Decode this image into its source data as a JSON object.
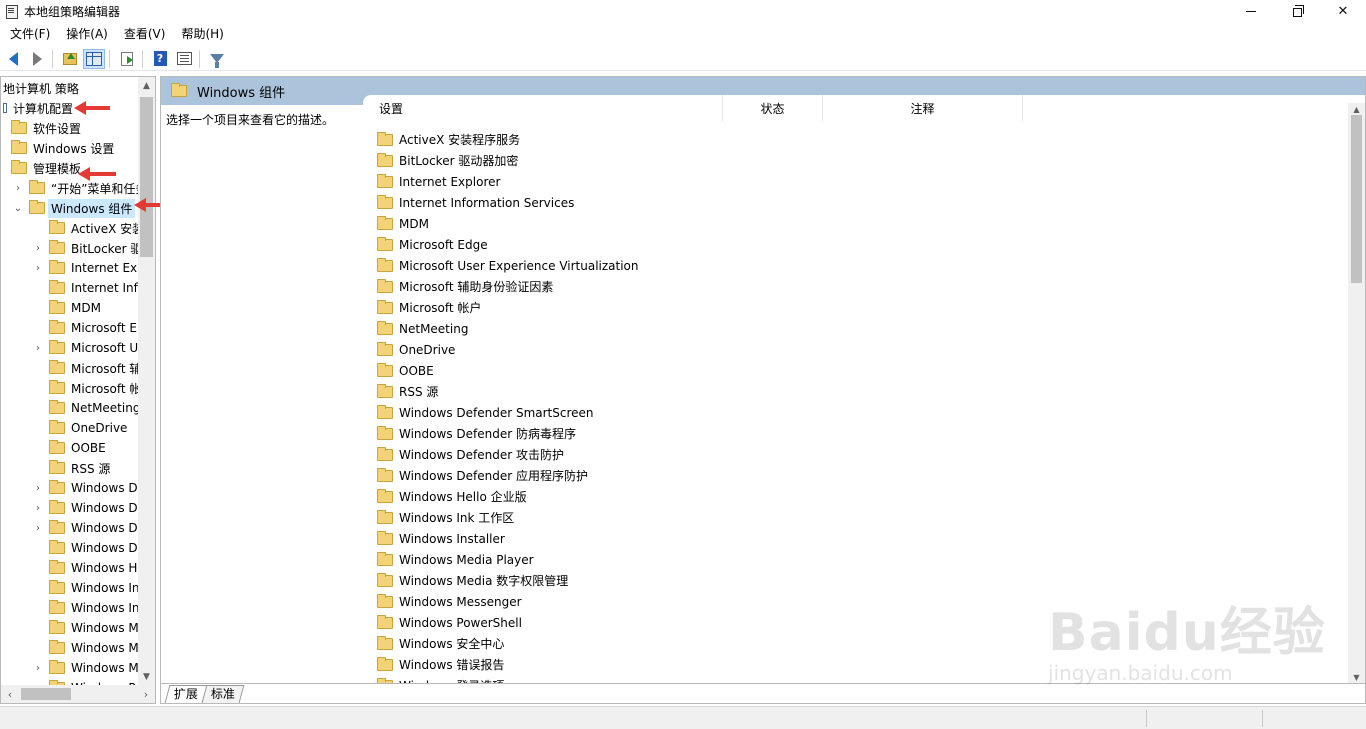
{
  "window": {
    "title": "本地组策略编辑器"
  },
  "menu": [
    "文件(F)",
    "操作(A)",
    "查看(V)",
    "帮助(H)"
  ],
  "toolbar": {
    "buttons": [
      "back-icon",
      "forward-icon",
      "up-folder-icon",
      "show-hide-tree-icon",
      "export-list-icon",
      "help-icon",
      "properties-icon",
      "filter-icon"
    ],
    "help_glyph": "?"
  },
  "tree": {
    "root": "地计算机 策略",
    "computer_config": "计算机配置",
    "software_settings": "软件设置",
    "windows_settings": "Windows 设置",
    "admin_templates": "管理模板",
    "start_menu": "“开始”菜单和任务",
    "windows_components": "Windows 组件",
    "children": [
      {
        "label": "ActiveX 安装",
        "expandable": false
      },
      {
        "label": "BitLocker 驱",
        "expandable": true
      },
      {
        "label": "Internet Exp",
        "expandable": true
      },
      {
        "label": "Internet Info",
        "expandable": false
      },
      {
        "label": "MDM",
        "expandable": false
      },
      {
        "label": "Microsoft E",
        "expandable": false
      },
      {
        "label": "Microsoft U",
        "expandable": true
      },
      {
        "label": "Microsoft 辅",
        "expandable": false
      },
      {
        "label": "Microsoft 帐",
        "expandable": false
      },
      {
        "label": "NetMeeting",
        "expandable": false
      },
      {
        "label": "OneDrive",
        "expandable": false
      },
      {
        "label": "OOBE",
        "expandable": false
      },
      {
        "label": "RSS 源",
        "expandable": false
      },
      {
        "label": "Windows De",
        "expandable": true
      },
      {
        "label": "Windows De",
        "expandable": true
      },
      {
        "label": "Windows De",
        "expandable": true
      },
      {
        "label": "Windows De",
        "expandable": false
      },
      {
        "label": "Windows He",
        "expandable": false
      },
      {
        "label": "Windows In",
        "expandable": false
      },
      {
        "label": "Windows In",
        "expandable": false
      },
      {
        "label": "Windows M",
        "expandable": false
      },
      {
        "label": "Windows M",
        "expandable": false
      },
      {
        "label": "Windows M",
        "expandable": true
      },
      {
        "label": "Windows P",
        "expandable": false
      }
    ]
  },
  "right": {
    "header": "Windows 组件",
    "description": "选择一个项目来查看它的描述。",
    "columns": [
      "设置",
      "状态",
      "注释"
    ],
    "items": [
      "ActiveX 安装程序服务",
      "BitLocker 驱动器加密",
      "Internet Explorer",
      "Internet Information Services",
      "MDM",
      "Microsoft Edge",
      "Microsoft User Experience Virtualization",
      "Microsoft 辅助身份验证因素",
      "Microsoft 帐户",
      "NetMeeting",
      "OneDrive",
      "OOBE",
      "RSS 源",
      "Windows Defender SmartScreen",
      "Windows Defender 防病毒程序",
      "Windows Defender 攻击防护",
      "Windows Defender 应用程序防护",
      "Windows Hello 企业版",
      "Windows Ink 工作区",
      "Windows Installer",
      "Windows Media Player",
      "Windows Media 数字权限管理",
      "Windows Messenger",
      "Windows PowerShell",
      "Windows 安全中心",
      "Windows 错误报告",
      "Windows 登录选项"
    ],
    "tabs": [
      "扩展",
      "标准"
    ]
  },
  "watermark": {
    "main": "Baidu经验",
    "sub": "jingyan.baidu.com"
  },
  "colors": {
    "header_bg": "#acc3dc",
    "selection": "#cce8ff",
    "annotation_arrow": "#e53935",
    "folder": "#f2d378"
  }
}
